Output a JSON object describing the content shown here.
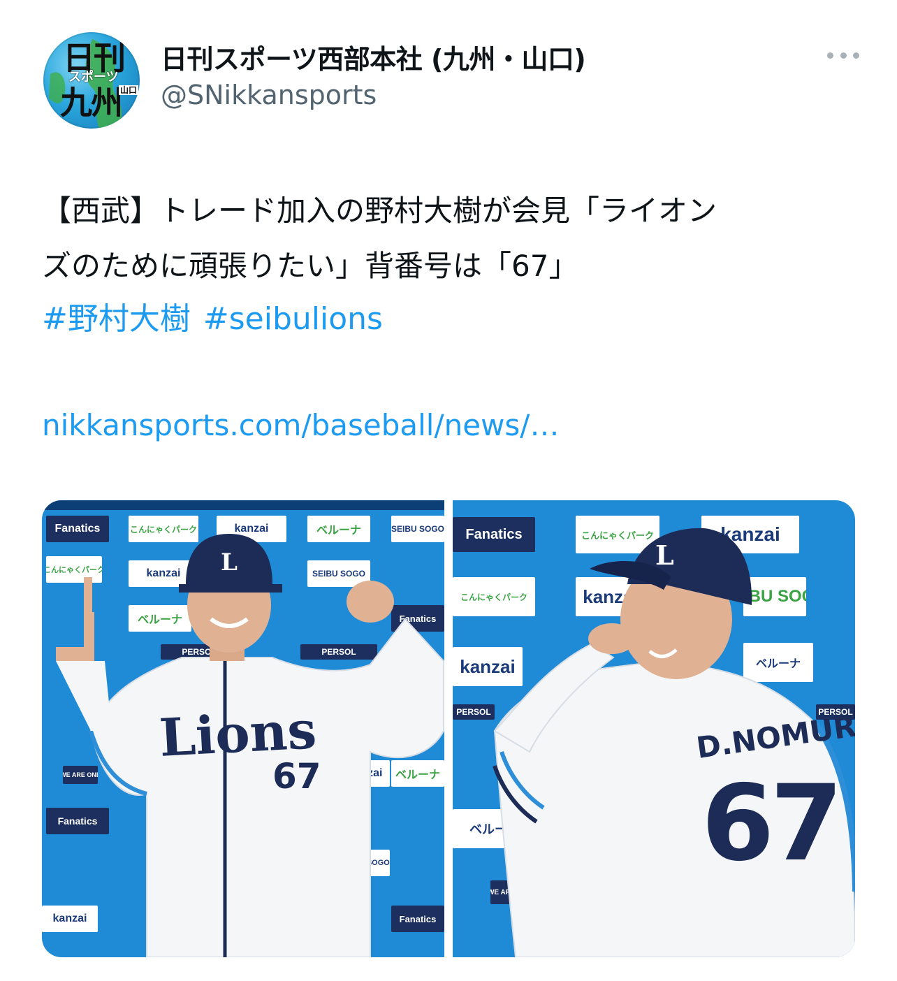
{
  "account": {
    "display_name": "日刊スポーツ西部本社 (九州・山口)",
    "handle": "@SNikkansports",
    "avatar_text": [
      "日刊",
      "スポーツ",
      "九州",
      "山口"
    ]
  },
  "tweet": {
    "text_line1": "【西武】トレード加入の野村大樹が会見「ライオン",
    "text_line2": "ズのために頑張りたい」背番号は「67」",
    "hashtags": [
      "#野村大樹",
      "#seibulions"
    ],
    "link": "nikkansports.com/baseball/news/…"
  },
  "media": {
    "left_photo": {
      "jersey_script": "Lions",
      "jersey_number": "67",
      "sponsors": [
        "Fanatics",
        "kanzai",
        "ベルーナ",
        "SEIBU SOGO",
        "PERSOL",
        "こんにゃくパーク",
        "WE ARE ONE"
      ]
    },
    "right_photo": {
      "name_on_back": "D.NOMURA",
      "jersey_number": "67",
      "sponsors": [
        "Fanatics",
        "kanzai",
        "SEIBU SOGO",
        "ベルーナ",
        "PERSOL",
        "こんにゃくパーク",
        "WE ARE ONE"
      ]
    }
  },
  "colors": {
    "link": "#1d9bf0",
    "handle": "#536471",
    "backdrop": "#1f8ad6",
    "team_navy": "#1c2c57"
  }
}
